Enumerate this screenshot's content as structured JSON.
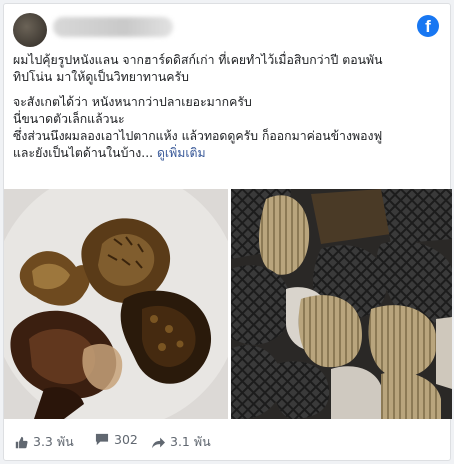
{
  "post": {
    "author": {
      "name": "",
      "avatar_icon": "avatar-icon"
    },
    "platform_icon": "facebook-icon",
    "text_lines": [
      "ผมไปคุ้ยรูปหนังแลน จากฮาร์ดดิสก์เก่า ที่เคยทำไว้เมื่อสิบกว่าปี ตอนพัน",
      "ทิปโน่น มาให้ดูเป็นวิทยาทานครับ",
      "จะสังเกตได้ว่า หนังหนากว่าปลาเยอะมากครับ",
      "นี่ขนาดตัวเล็กแล้วนะ",
      "ซึ่งส่วนนึงผมลองเอาไปตากแห้ง แล้วทอดดูครับ ก็ออกมาค่อนข้างพองฟู",
      "และยังเป็นไตด้านในบ้าง..."
    ],
    "see_more": "ดูเพิ่มเติม",
    "stats": {
      "likes": "3.3 พัน",
      "comments": "302",
      "shares": "3.1 พัน"
    }
  },
  "colors": {
    "facebook_blue": "#1877f2",
    "link": "#385898",
    "meta_text": "#606770"
  }
}
